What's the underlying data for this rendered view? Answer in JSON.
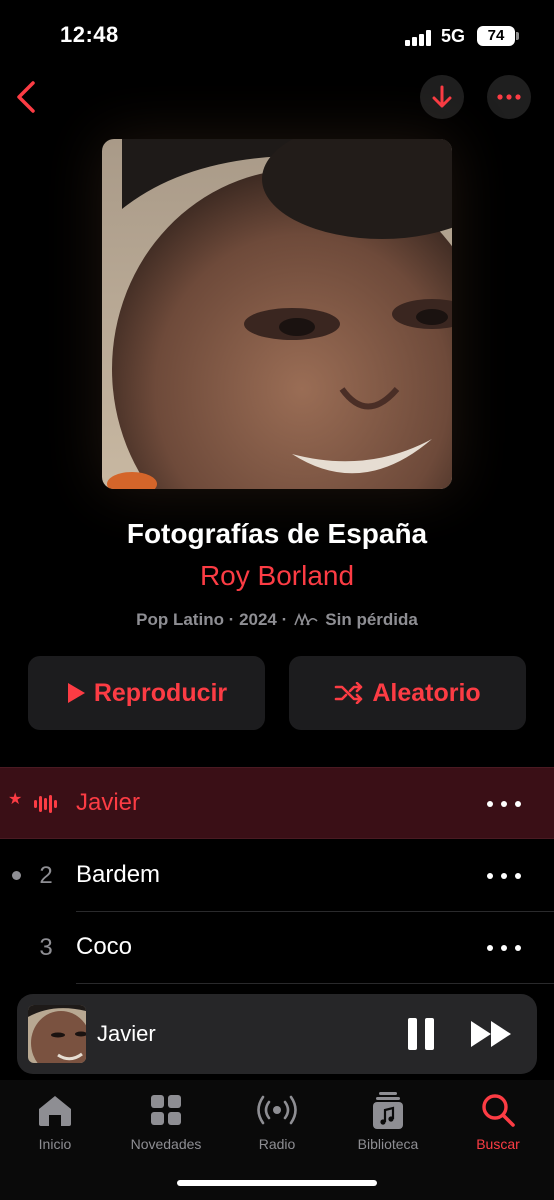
{
  "status_bar": {
    "time": "12:48",
    "network": "5G",
    "battery": "74"
  },
  "nav": {
    "back_icon": "chevron-left-icon",
    "download_icon": "arrow-down-icon",
    "more_icon": "ellipsis-icon"
  },
  "album": {
    "title": "Fotografías de España",
    "artist": "Roy Borland",
    "genre_year": "Pop Latino · 2024 ·",
    "quality": "Sin pérdida"
  },
  "actions": {
    "play_label": "Reproducir",
    "shuffle_label": "Aleatorio"
  },
  "tracks": [
    {
      "number": "",
      "title": "Javier",
      "playing": true
    },
    {
      "number": "2",
      "title": "Bardem",
      "playing": false
    },
    {
      "number": "3",
      "title": "Coco",
      "playing": false
    }
  ],
  "mini_player": {
    "title": "Javier"
  },
  "tabs": [
    {
      "label": "Inicio",
      "icon": "home-icon"
    },
    {
      "label": "Novedades",
      "icon": "grid-icon"
    },
    {
      "label": "Radio",
      "icon": "radio-icon"
    },
    {
      "label": "Biblioteca",
      "icon": "library-icon"
    },
    {
      "label": "Buscar",
      "icon": "search-icon",
      "active": true
    }
  ],
  "colors": {
    "accent": "#fc3c44",
    "background": "#000000",
    "secondary_text": "#8e8e93"
  }
}
